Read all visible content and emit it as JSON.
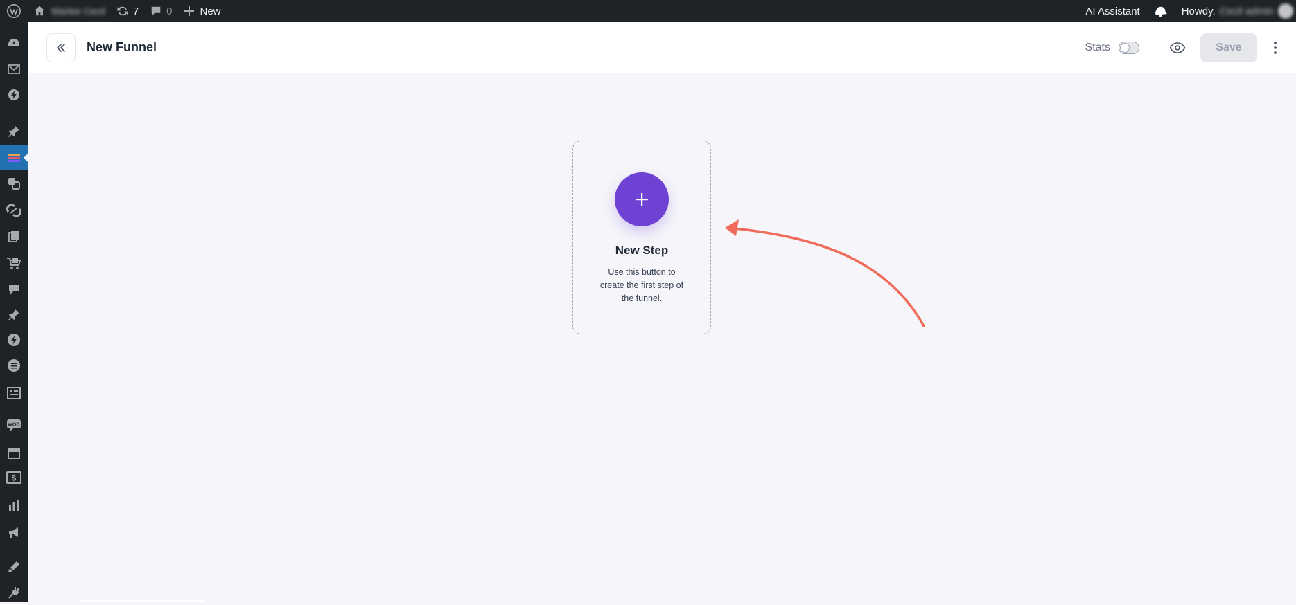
{
  "adminbar": {
    "site_name": "Marlee Cecil",
    "updates_count": "7",
    "comments_count": "0",
    "new_label": "New",
    "ai_assistant_label": "AI Assistant",
    "howdy_label": "Howdy,",
    "user_name": "Cecil admin"
  },
  "sidebar": {
    "icons": [
      "dashboard-icon",
      "mail-icon",
      "bolt-icon",
      "pin-icon",
      "funnel-icon",
      "media-icon",
      "link-icon",
      "pages-icon",
      "cart-icon",
      "comments-icon",
      "pin-icon",
      "lightning-icon",
      "elementor-icon",
      "forms-icon",
      "woo-icon",
      "archive-icon",
      "dollar-icon",
      "analytics-icon",
      "marketing-icon",
      "appearance-icon",
      "plugins-icon"
    ],
    "active": "funnel-icon"
  },
  "header": {
    "title": "New Funnel",
    "stats_label": "Stats",
    "stats_enabled": false,
    "save_label": "Save"
  },
  "canvas": {
    "step_title": "New Step",
    "step_description": "Use this button to create the first step of the funnel."
  },
  "colors": {
    "accent": "#6e42d3",
    "annotation_arrow": "#f06b5a",
    "adminbar_bg": "#1d2327",
    "active_menu": "#2271b1"
  }
}
